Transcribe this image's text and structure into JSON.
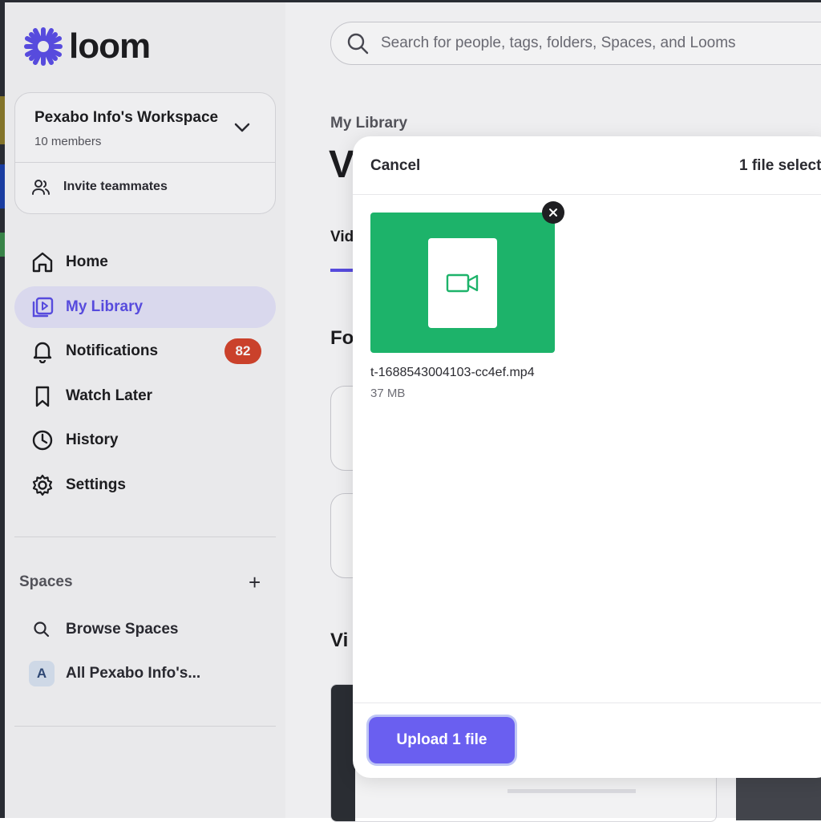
{
  "app": {
    "logo_text": "loom",
    "brand_color": "#5b4ee8"
  },
  "sidebar": {
    "workspace": {
      "name": "Pexabo Info's Workspace",
      "members": "10 members",
      "invite_label": "Invite teammates"
    },
    "items": [
      {
        "label": "Home",
        "icon": "home-icon"
      },
      {
        "label": "My Library",
        "icon": "library-icon",
        "active": true
      },
      {
        "label": "Notifications",
        "icon": "bell-icon",
        "badge": "82"
      },
      {
        "label": "Watch Later",
        "icon": "bookmark-icon"
      },
      {
        "label": "History",
        "icon": "clock-icon"
      },
      {
        "label": "Settings",
        "icon": "gear-icon"
      }
    ],
    "spaces": {
      "header": "Spaces",
      "add_label": "+",
      "items": [
        {
          "label": "Browse Spaces",
          "icon": "search-icon"
        },
        {
          "label": "All Pexabo Info's...",
          "avatar": "A"
        }
      ]
    }
  },
  "main": {
    "search_placeholder": "Search for people, tags, folders, Spaces, and Looms",
    "breadcrumb": "My Library",
    "title_peek": "V",
    "tab_peek": "Vid",
    "section1_peek": "Fo",
    "section2_peek": "Vi"
  },
  "modal": {
    "cancel_label": "Cancel",
    "selected_text": "1 file select",
    "file": {
      "name": "t-1688543004103-cc4ef.mp4",
      "size": "37 MB",
      "thumb_color": "#1db36a"
    },
    "upload_label": "Upload 1 file"
  }
}
